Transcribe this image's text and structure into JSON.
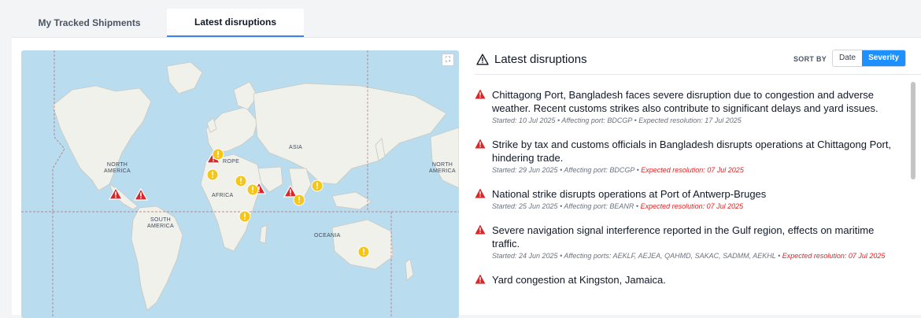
{
  "tabs": [
    {
      "label": "My Tracked Shipments",
      "active": false
    },
    {
      "label": "Latest disruptions",
      "active": true
    }
  ],
  "map": {
    "labels": {
      "asia": "ASIA",
      "europe": "ROPE",
      "north_america_left": "NORTH\nAMERICA",
      "north_america_right": "NORTH\nAMERICA",
      "africa": "AFRICA",
      "south_america": "SOUTH\nAMERICA",
      "oceania": "OCEANIA"
    },
    "expand_icon": "⛶",
    "colors": {
      "ocean": "#b9dcef",
      "land": "#f1f1ec",
      "severe": "#d62828",
      "warning": "#f5c518"
    }
  },
  "panel": {
    "title": "Latest disruptions",
    "title_icon": "warning-triangle-outline-icon",
    "sort": {
      "label": "SORT BY",
      "options": [
        "Date",
        "Severity"
      ],
      "selected": "Severity"
    }
  },
  "disruptions": [
    {
      "title": "Chittagong Port, Bangladesh faces severe disruption due to congestion and adverse weather. Recent customs strikes also contribute to significant delays and yard issues.",
      "meta": "Started: 10 Jul 2025 • Affecting port: BDCGP • Expected resolution: 17 Jul 2025",
      "meta_alert": ""
    },
    {
      "title": "Strike by tax and customs officials in Bangladesh disrupts operations at Chittagong Port, hindering trade.",
      "meta": "Started: 29 Jun 2025 • Affecting port: BDCGP • ",
      "meta_alert": "Expected resolution: 07 Jul 2025"
    },
    {
      "title": "National strike disrupts operations at Port of Antwerp-Bruges",
      "meta": "Started: 25 Jun 2025 • Affecting port: BEANR • ",
      "meta_alert": "Expected resolution: 07 Jul 2025"
    },
    {
      "title": "Severe navigation signal interference reported in the Gulf region, effects on maritime traffic.",
      "meta": "Started: 24 Jun 2025 • Affecting ports: AEKLF, AEJEA, QAHMD, SAKAC, SADMM, AEKHL • ",
      "meta_alert": "Expected resolution: 07 Jul 2025"
    },
    {
      "title": "Yard congestion at Kingston, Jamaica.",
      "meta": "",
      "meta_alert": ""
    }
  ]
}
